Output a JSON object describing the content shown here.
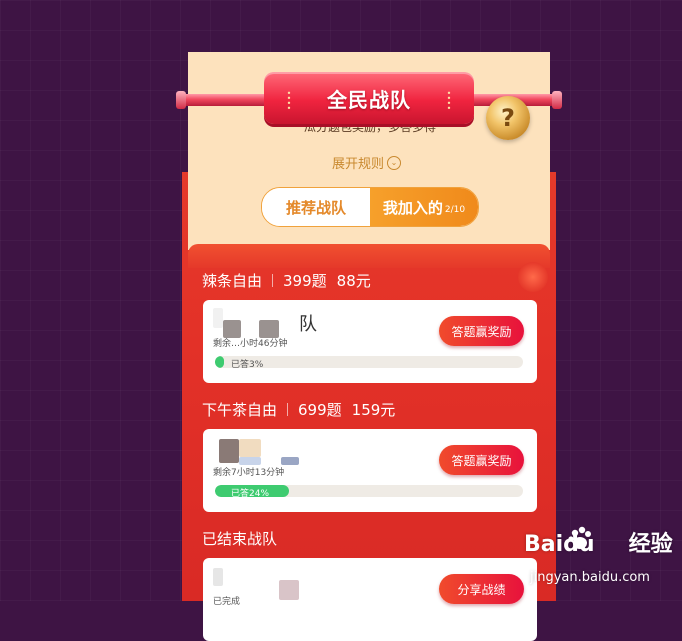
{
  "header": {
    "banner_title": "全民战队",
    "subtitle": "瓜分题包奖励，多答多得",
    "rules_label": "展开规则",
    "help_icon": "question-mark-icon"
  },
  "tabs": [
    {
      "label": "推荐战队",
      "active": false
    },
    {
      "label": "我加入的",
      "count": "2/10",
      "active": true
    }
  ],
  "groups": [
    {
      "title": "辣条自由",
      "questions": "399题",
      "prize": "88元",
      "card": {
        "name": "队",
        "meta": "剩余…小时46分钟",
        "progress": 0.03,
        "progress_label": "已答3%",
        "button": "答题赢奖励"
      }
    },
    {
      "title": "下午茶自由",
      "questions": "699题",
      "prize": "159元",
      "card": {
        "name": "",
        "meta": "剩余7小时13分钟",
        "progress": 0.24,
        "progress_label": "已答24%",
        "button": "答题赢奖励"
      }
    }
  ],
  "ended": {
    "title": "已结束战队",
    "card": {
      "meta": "已完成",
      "button": "分享战绩"
    }
  },
  "watermark": {
    "brand": "Baidu",
    "suffix": "经验",
    "url": "jingyan.baidu.com"
  },
  "colors": {
    "background": "#3e1444",
    "cream": "#fde2bd",
    "red": "#e33128",
    "orange": "#f08a1b",
    "green": "#3ecb70"
  }
}
